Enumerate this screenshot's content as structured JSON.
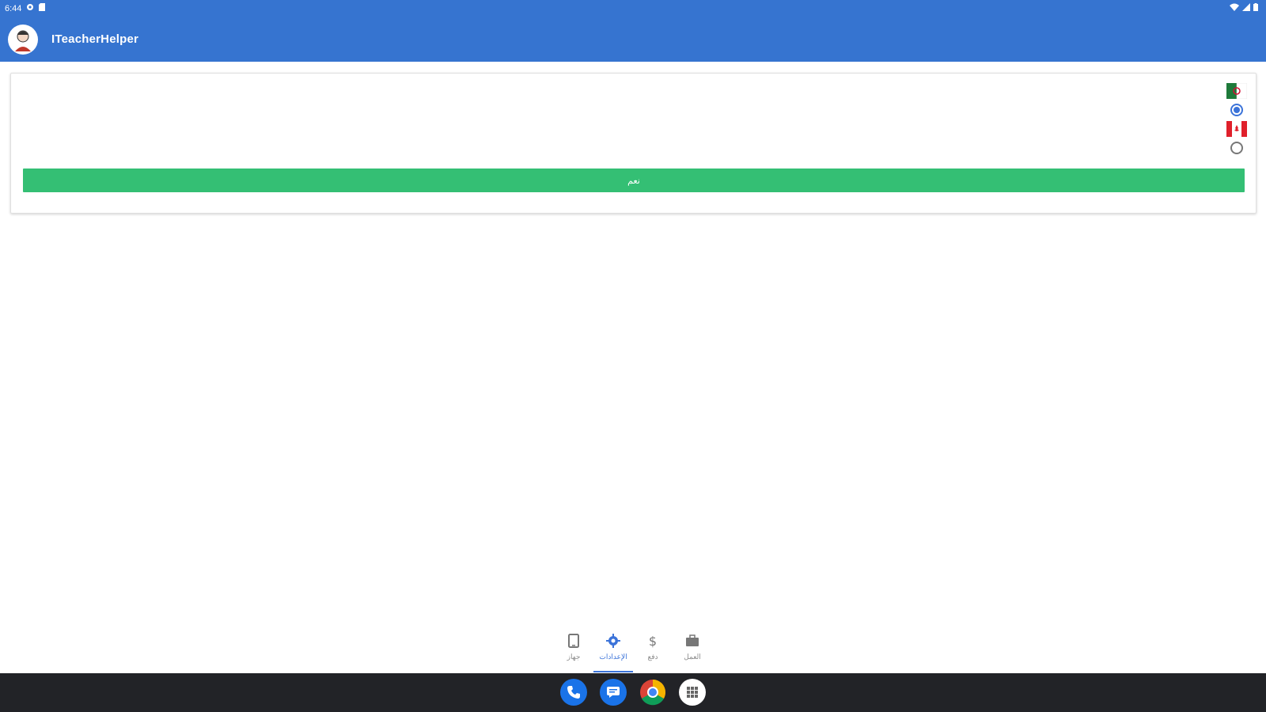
{
  "status_bar": {
    "time": "6:44"
  },
  "app": {
    "title": "ITeacherHelper"
  },
  "language_options": [
    {
      "flag": "algeria-flag",
      "selected": true
    },
    {
      "flag": "canada-flag",
      "selected": false
    }
  ],
  "main_button": {
    "label": "نعم"
  },
  "bottom_nav": [
    {
      "icon": "phone-device-icon",
      "label": "جهاز",
      "active": false
    },
    {
      "icon": "settings-icon",
      "label": "الإعدادات",
      "active": true
    },
    {
      "icon": "dollar-icon",
      "label": "دفع",
      "active": false
    },
    {
      "icon": "briefcase-icon",
      "label": "العمل",
      "active": false
    }
  ],
  "dock": [
    "phone-app-icon",
    "messages-app-icon",
    "chrome-app-icon",
    "app-grid-icon"
  ],
  "colors": {
    "primary": "#3674d0",
    "button": "#34bf74",
    "dock": "#222327",
    "accent": "#3b73d9"
  }
}
